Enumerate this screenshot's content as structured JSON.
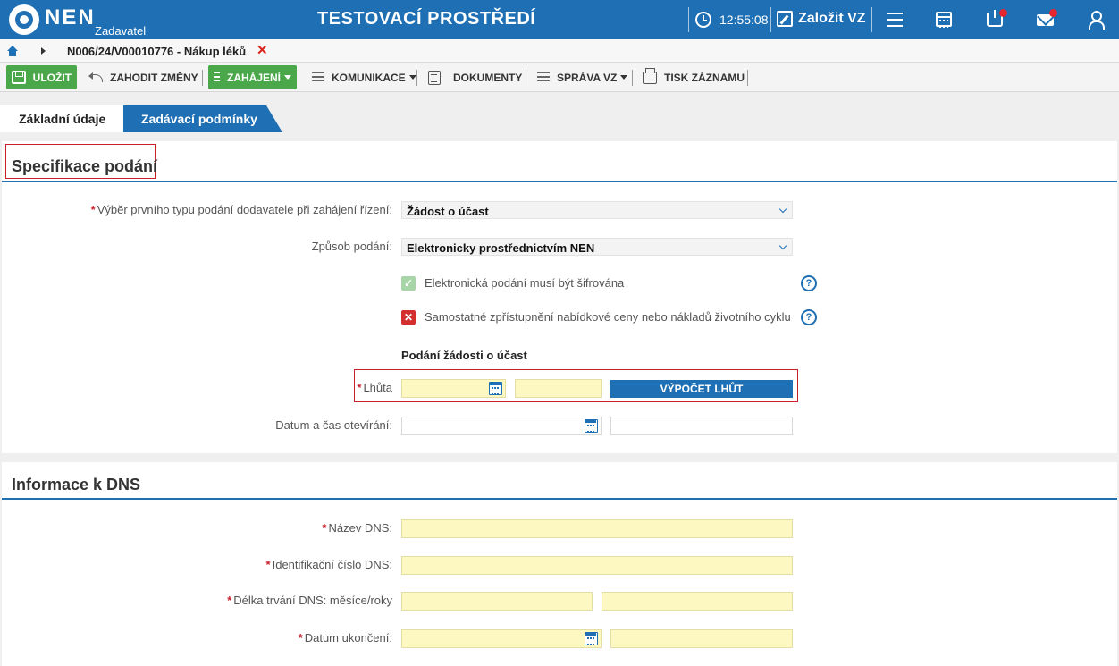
{
  "header": {
    "brand": "NEN",
    "brand_sub": "Zadavatel",
    "env_title": "TESTOVACÍ PROSTŘEDÍ",
    "clock": "12:55:08",
    "create_label": "Založit VZ",
    "badge_color": "#e4262d",
    "accent_color": "#1e6fb4"
  },
  "breadcrumb": {
    "item": "N006/24/V00010776 - Nákup léků",
    "close": "✕"
  },
  "toolbar": {
    "save": "ULOŽIT",
    "discard": "ZAHODIT ZMĚNY",
    "start": "ZAHÁJENÍ",
    "communication": "KOMUNIKACE",
    "documents": "DOKUMENTY",
    "management": "SPRÁVA VZ",
    "print": "TISK ZÁZNAMU"
  },
  "tabs": {
    "basic": "Základní údaje",
    "conditions": "Zadávací podmínky"
  },
  "spec": {
    "title": "Specifikace podání",
    "first_type_label": "Výběr prvního typu podání dodavatele při zahájení řízení:",
    "first_type_value": "Žádost o účast",
    "method_label": "Způsob podání:",
    "method_value": "Elektronicky prostřednictvím NEN",
    "encrypted_label": "Elektronická podání musí být šifrována",
    "encrypted_checked": true,
    "separate_label": "Samostatné zpřístupnění nabídkové ceny nebo nákladů životního cyklu",
    "separate_checked": false,
    "check_on": "✓",
    "check_off": "✕",
    "help": "?",
    "subsection": "Podání žádosti o účast",
    "deadline_label": "Lhůta",
    "calc_button": "VÝPOČET LHŮT",
    "opening_label": "Datum a čas otevírání:"
  },
  "dns": {
    "title": "Informace k DNS",
    "name_label": "Název DNS:",
    "id_label": "Identifikační číslo DNS:",
    "duration_label": "Délka trvání DNS: měsíce/roky",
    "end_label": "Datum ukončení:"
  },
  "required_mark": "*"
}
